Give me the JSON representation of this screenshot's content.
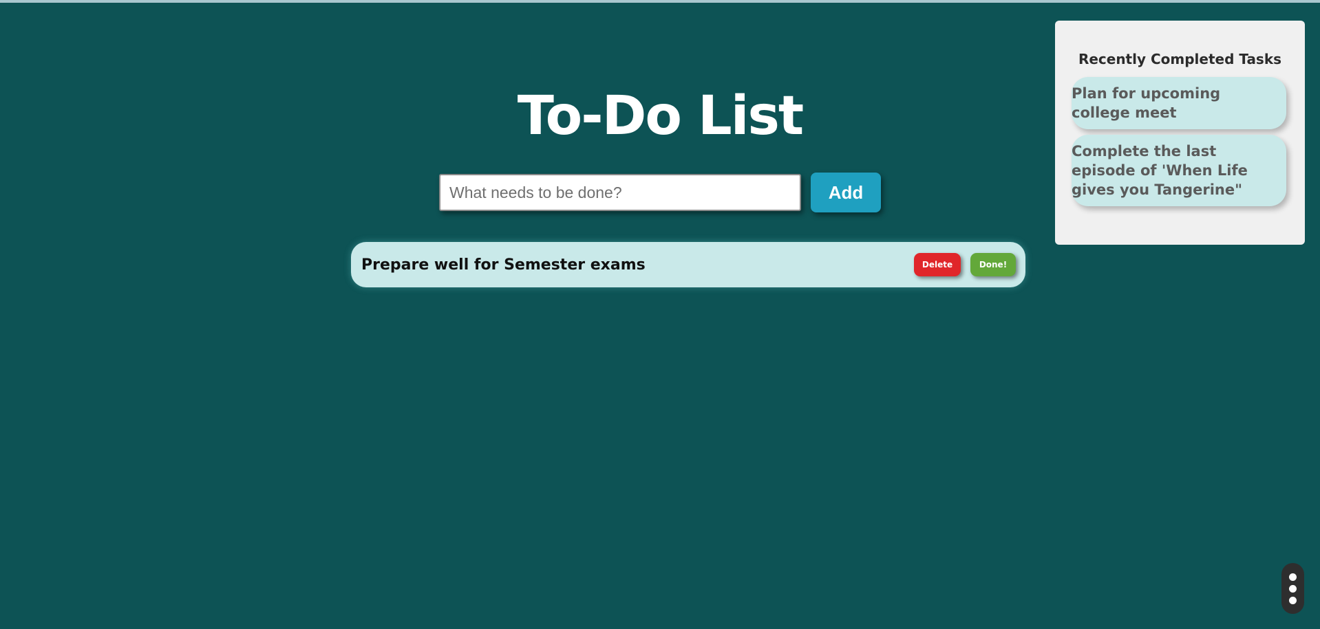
{
  "header": {
    "title": "To-Do List"
  },
  "add_form": {
    "placeholder": "What needs to be done?",
    "value": "",
    "add_label": "Add"
  },
  "todos": [
    {
      "text": "Prepare well for Semester exams",
      "delete_label": "Delete",
      "done_label": "Done!"
    }
  ],
  "completed": {
    "title": "Recently Completed Tasks",
    "items": [
      "Plan for upcoming college meet",
      "Complete the last episode of 'When Life gives you Tangerine\""
    ]
  },
  "colors": {
    "background": "#0d5355",
    "item_background": "#c9e9e9",
    "add_button": "#1fa0c0",
    "delete_button": "#e0262a",
    "done_button": "#63a83a",
    "panel_background": "#f0f0f0"
  },
  "icons": {
    "more_menu": "vertical-dots-icon"
  }
}
